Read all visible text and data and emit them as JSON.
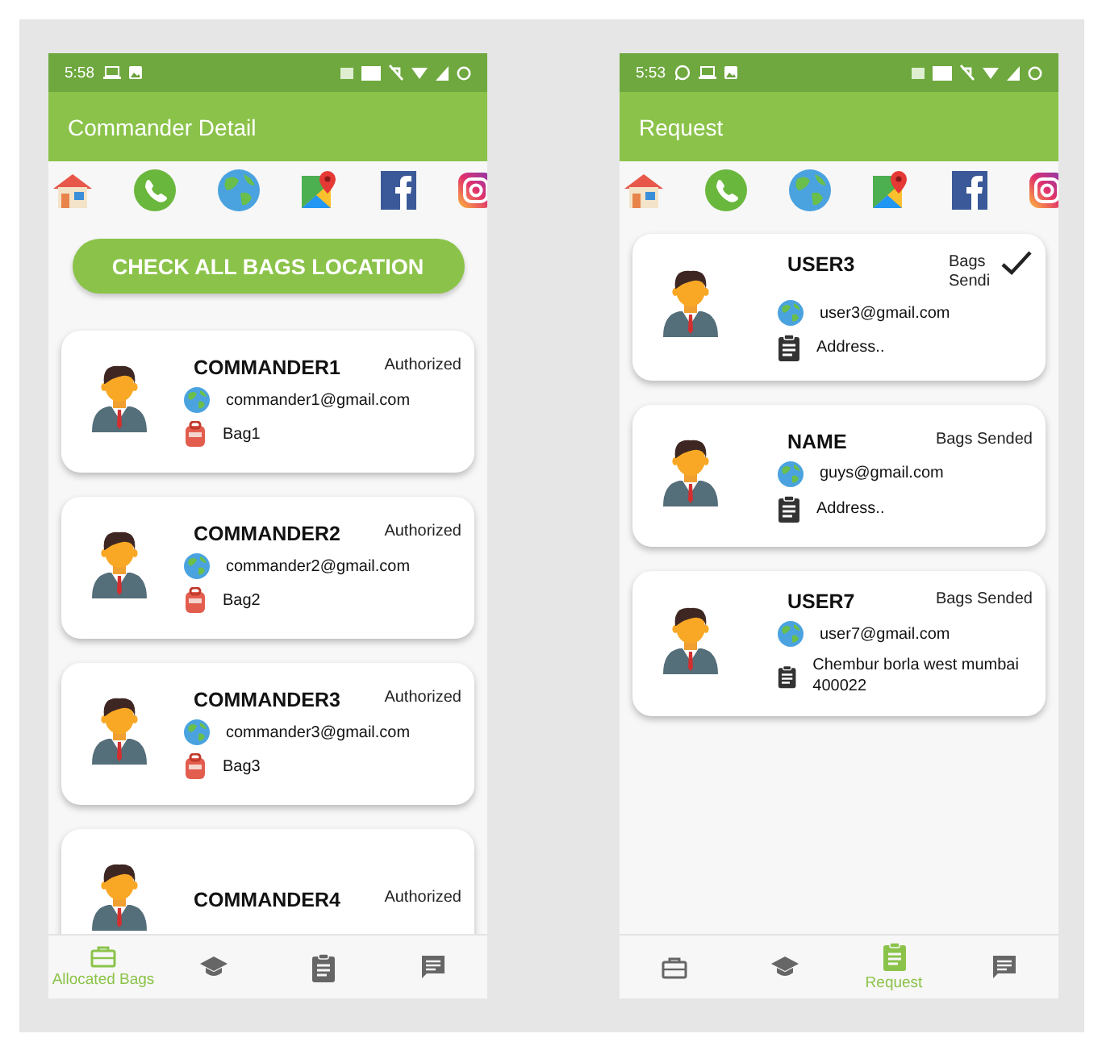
{
  "screens": [
    {
      "status_bar": {
        "time": "5:58",
        "icons": [
          {
            "kind": "laptop"
          },
          {
            "kind": "image"
          }
        ]
      },
      "title": "Commander Detail",
      "action_button": "CHECK ALL BAGS LOCATION",
      "cards": [
        {
          "kind": "commander",
          "name": "COMMANDER1",
          "status": "Authorized",
          "email": "commander1@gmail.com",
          "detail": "Bag1",
          "checked": false
        },
        {
          "kind": "commander",
          "name": "COMMANDER2",
          "status": "Authorized",
          "email": "commander2@gmail.com",
          "detail": "Bag2",
          "checked": false
        },
        {
          "kind": "commander",
          "name": "COMMANDER3",
          "status": "Authorized",
          "email": "commander3@gmail.com",
          "detail": "Bag3",
          "checked": false
        },
        {
          "kind": "commander",
          "name": "COMMANDER4",
          "status": "Authorized",
          "checked": false
        }
      ],
      "nav": [
        {
          "kind": "briefcase",
          "label": "Allocated Bags",
          "selected": true
        },
        {
          "kind": "school",
          "selected": false
        },
        {
          "kind": "clipboard",
          "selected": false
        },
        {
          "kind": "message",
          "selected": false
        }
      ]
    },
    {
      "status_bar": {
        "time": "5:53",
        "icons": [
          {
            "kind": "whatsapp"
          },
          {
            "kind": "laptop"
          },
          {
            "kind": "image"
          }
        ]
      },
      "title": "Request",
      "cards": [
        {
          "kind": "request",
          "name": "USER3",
          "status": "Bags Sendi",
          "email": "user3@gmail.com",
          "detail": "Address..",
          "checked": true
        },
        {
          "kind": "request",
          "name": "NAME",
          "status": "Bags Sended",
          "email": "guys@gmail.com",
          "detail": "Address..",
          "checked": false
        },
        {
          "kind": "request",
          "name": "USER7",
          "status": "Bags Sended",
          "email": "user7@gmail.com",
          "detail": "Chembur borla west mumbai 400022",
          "checked": false
        }
      ],
      "nav": [
        {
          "kind": "briefcase",
          "selected": false
        },
        {
          "kind": "school",
          "selected": false
        },
        {
          "kind": "clipboard",
          "label": "Request",
          "selected": true
        },
        {
          "kind": "message",
          "selected": false
        }
      ]
    }
  ]
}
